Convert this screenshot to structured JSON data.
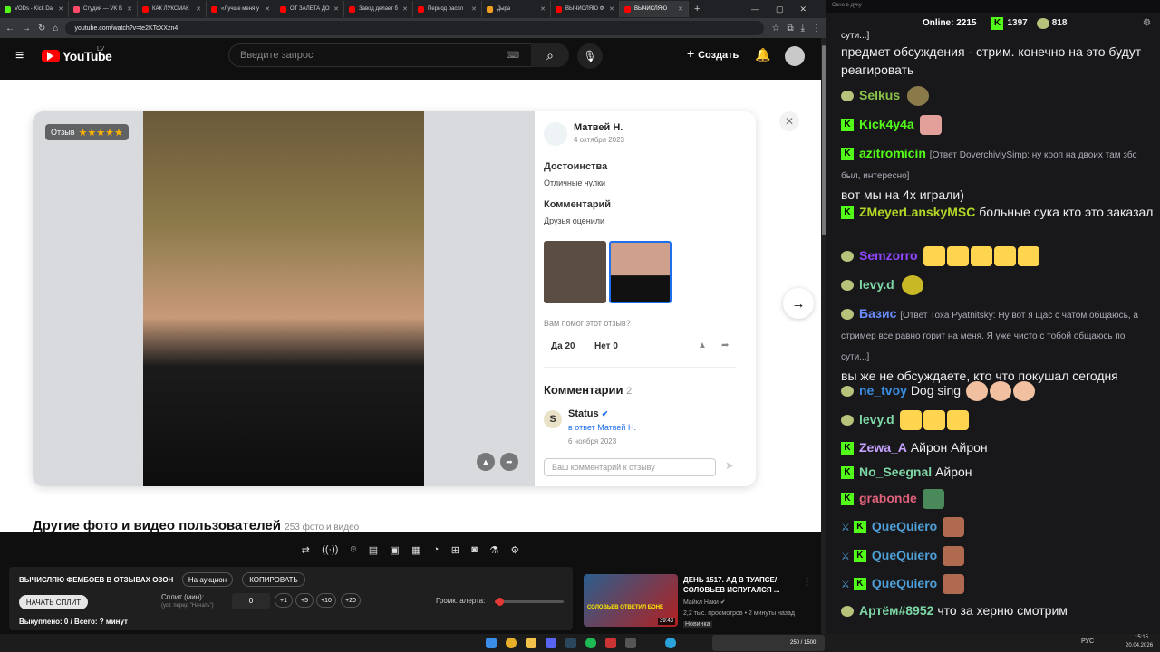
{
  "browser": {
    "tabs": [
      "VODs - Kick Da",
      "Студия — VK В",
      "КАК ЛУКСМАК",
      "«Лучше меня у",
      "ОТ ЗАЛЕТА ДО",
      "Завод делает б",
      "Период распл",
      "Дыра",
      "ВЫЧИСЛЯЮ Ф",
      "ВЫЧИСЛЯЮ"
    ],
    "url": "youtube.com/watch?v=te2KTcXXzn4"
  },
  "youtube": {
    "logo": "YouTube",
    "region": "LV",
    "search_placeholder": "Введите запрос",
    "create_label": "Создать"
  },
  "review": {
    "badge": "Отзыв",
    "stars": 5,
    "author": "Матвей Н.",
    "date": "4 октября 2023",
    "pros_title": "Достоинства",
    "pros_text": "Отличные чулки",
    "comment_title": "Комментарий",
    "comment_text": "Друзья оценили",
    "helpful_q": "Вам помог этот отзыв?",
    "yes": "Да 20",
    "no": "Нет 0",
    "comments_title": "Комментарии",
    "comments_count": "2",
    "reply_author": "Status",
    "reply_to": "в ответ Матвей Н.",
    "reply_date": "6 ноября 2023",
    "input_placeholder": "Ваш комментарий к отзыву"
  },
  "section": {
    "title": "Другие фото и видео пользователей",
    "count": "253 фото и видео"
  },
  "panel": {
    "title": "ВЫЧИСЛЯЮ ФЕМБОЕВ В ОТЗЫВАХ ОЗОН",
    "auction": "На аукцион",
    "copy": "КОПИРОВАТЬ",
    "start_split": "НАЧАТЬ СПЛИТ",
    "split_label": "Сплит (мин):",
    "split_hint": "(уст. перед \"Начать\")",
    "split_value": "0",
    "increments": [
      "+1",
      "+5",
      "+10",
      "+20"
    ],
    "alert_volume": "Громк. алерта:",
    "alert_volume_level": 0.07,
    "bought": "Выкуплено: 0 / Всего: ? минут"
  },
  "related": {
    "title": "ДЕНЬ 1517. АД В ТУАПСЕ/ СОЛОВЬЕВ ИСПУГАЛСЯ ...",
    "channel": "Майкл Наки",
    "meta": "2,2 тыс. просмотров • 2 минуты назад",
    "badge": "Новинка",
    "duration": "39:43",
    "thumb_text": "СОЛОВЬЕВ ОТВЕТИЛ БОНЕ"
  },
  "chat": {
    "header": "Окно в дуку",
    "online_label": "Online:",
    "online": "2215",
    "kick_count": "1397",
    "other_count": "818",
    "messages": [
      {
        "text": "сути...]"
      },
      {
        "text": "предмет обсуждения - стрим. конечно на это будут реагировать"
      },
      {
        "user": "Selkus",
        "color": "#8bc34a"
      },
      {
        "user": "Kick4y4a",
        "color": "#53fc18"
      },
      {
        "user": "azitromicin",
        "color": "#53fc18",
        "reply": "[Ответ DoverchiviySimp: ну кооп на двоих там збс был, интересно]",
        "text": "вот мы на 4х играли)"
      },
      {
        "user": "ZMeyerLanskyMSC",
        "color": "#b2d826",
        "text": "больные сука кто это заказал"
      },
      {
        "user": "Semzorro",
        "color": "#9146ff"
      },
      {
        "user": "levy.d",
        "color": "#7ed6a5"
      },
      {
        "user": "Базис",
        "color": "#6a8cff",
        "reply": "[Ответ Тоха Pyatnitsky: Ну вот я щас с чатом общаюсь, а стример все равно горит на меня. Я уже чисто с тобой общаюсь по сути...]",
        "text": "вы же не обсуждаете, кто что покушал сегодня"
      },
      {
        "user": "ne_tvoy",
        "color": "#3a8ce0",
        "text": "Dog sing"
      },
      {
        "user": "levy.d",
        "color": "#7ed6a5"
      },
      {
        "user": "Zewa_A",
        "color": "#c6a3ff",
        "text": "Айрон Айрон"
      },
      {
        "user": "No_Seegnal",
        "color": "#7ed6a5",
        "text": "Айрон"
      },
      {
        "user": "grabonde",
        "color": "#e0627a"
      },
      {
        "user": "QueQuiero",
        "color": "#4e9fd6"
      },
      {
        "user": "QueQuiero",
        "color": "#4e9fd6"
      },
      {
        "user": "QueQuiero",
        "color": "#4e9fd6"
      },
      {
        "user": "Артём#8952",
        "color": "#7ed6a5",
        "text": "что за херню смотрим"
      }
    ]
  },
  "taskbar": {
    "lang": "РУС",
    "time": "15:15",
    "date": "20.04.2026",
    "widget": "250 / 1500"
  }
}
